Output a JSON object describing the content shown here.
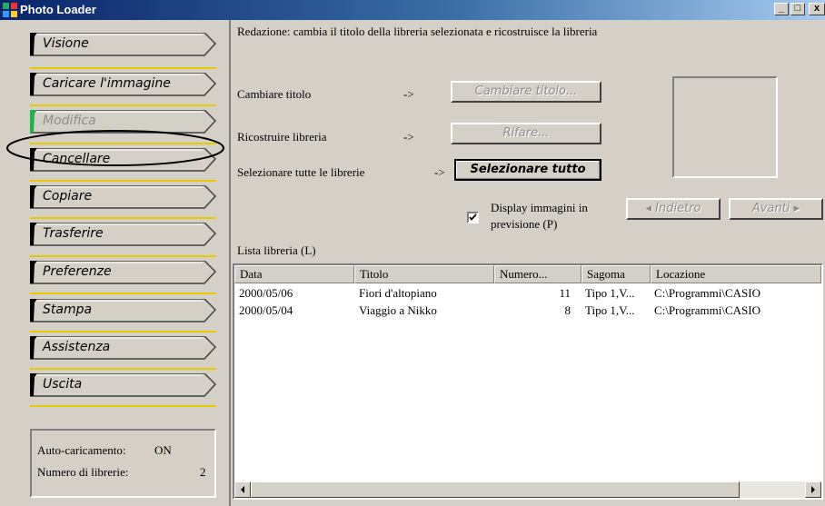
{
  "window": {
    "title": "Photo Loader",
    "minimize": "_",
    "maximize": "□",
    "close": "x"
  },
  "sidebar": {
    "items": [
      {
        "label": "Visione",
        "disabled": false
      },
      {
        "label": "Caricare l'immagine",
        "disabled": false
      },
      {
        "label": "Modifica",
        "disabled": true,
        "selected": true
      },
      {
        "label": "Cancellare",
        "disabled": false
      },
      {
        "label": "Copiare",
        "disabled": false
      },
      {
        "label": "Trasferire",
        "disabled": false
      },
      {
        "label": "Preferenze",
        "disabled": false
      },
      {
        "label": "Stampa",
        "disabled": false
      },
      {
        "label": "Assistenza",
        "disabled": false
      },
      {
        "label": "Uscita",
        "disabled": false
      }
    ],
    "status": {
      "autoload_label": "Auto-caricamento:",
      "autoload_value": "ON",
      "count_label": "Numero di librerie:",
      "count_value": "2"
    }
  },
  "main": {
    "description": "Redazione: cambia il titolo della libreria selezionata e ricostruisce la libreria",
    "rows": [
      {
        "label": "Cambiare titolo",
        "arrow": "->",
        "button": "Cambiare titolo..."
      },
      {
        "label": "Ricostruire libreria",
        "arrow": "->",
        "button": "Rifare..."
      },
      {
        "label": "Selezionare tutte le librerie",
        "arrow": "->",
        "button": "Selezionare tutto"
      }
    ],
    "preview_checkbox": {
      "line1": "Display immagini in",
      "line2": "previsione (P)",
      "checked": true
    },
    "nav": {
      "back": "Indietro",
      "forward": "Avanti"
    },
    "list_label": "Lista libreria (L)",
    "columns": [
      "Data",
      "Titolo",
      "Numero...",
      "Sagoma",
      "Locazione"
    ],
    "libraries": [
      {
        "data": "2000/05/06",
        "titolo": "Fiori d'altopiano",
        "numero": "11",
        "sagoma": "Tipo 1,V...",
        "locazione": "C:\\Programmi\\CASIO"
      },
      {
        "data": "2000/05/04",
        "titolo": "Viaggio a Nikko",
        "numero": "8",
        "sagoma": "Tipo 1,V...",
        "locazione": "C:\\Programmi\\CASIO"
      }
    ]
  },
  "colors": {
    "titlebar_start": "#0a246a",
    "titlebar_end": "#a6caf0",
    "face": "#d4d0c8",
    "separator": "#e8c800",
    "selected_marker": "#22b14c"
  }
}
